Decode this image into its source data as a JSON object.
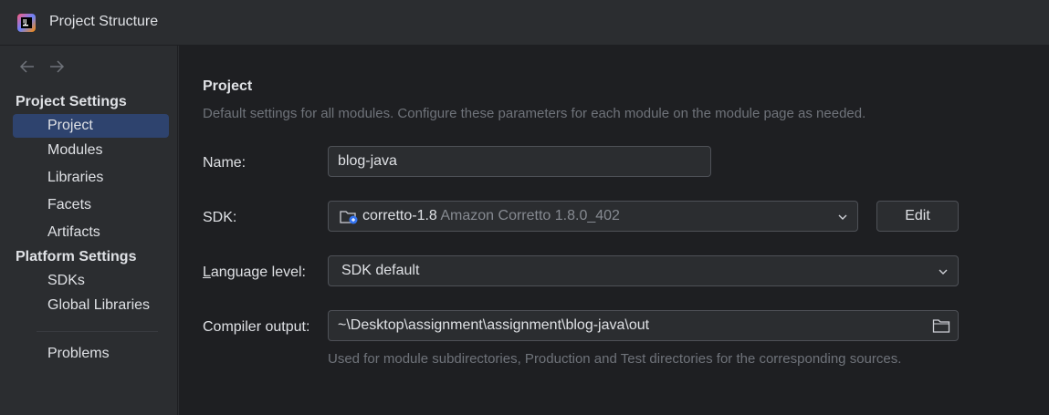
{
  "window": {
    "title": "Project Structure",
    "logo_icon": "intellij-idea-logo"
  },
  "sidebar": {
    "nav": {
      "back_icon": "arrow-left-icon",
      "forward_icon": "arrow-right-icon"
    },
    "project_settings_header": "Project Settings",
    "project_settings_items": [
      "Project",
      "Modules",
      "Libraries",
      "Facets",
      "Artifacts"
    ],
    "platform_settings_header": "Platform Settings",
    "platform_settings_items": [
      "SDKs",
      "Global Libraries"
    ],
    "other_items": [
      "Problems"
    ],
    "selected": "Project"
  },
  "main": {
    "heading": "Project",
    "description": "Default settings for all modules. Configure these parameters for each module on the module page as needed.",
    "name": {
      "label": "Name:",
      "value": "blog-java"
    },
    "sdk": {
      "label": "SDK:",
      "value_name": "corretto-1.8",
      "value_detail": "Amazon Corretto 1.8.0_402",
      "edit_button": "Edit"
    },
    "language_level": {
      "label_first": "L",
      "label_rest": "anguage level:",
      "value": "SDK default"
    },
    "compiler_output": {
      "label": "Compiler output:",
      "value": "~\\Desktop\\assignment\\assignment\\blog-java\\out",
      "hint": "Used for module subdirectories, Production and Test directories for the corresponding sources."
    }
  },
  "colors": {
    "background": "#1e1f22",
    "panel": "#2b2d30",
    "selection": "#2e436e",
    "border": "#4e5157",
    "muted_text": "#6f737a",
    "accent_blue": "#3574f0"
  }
}
